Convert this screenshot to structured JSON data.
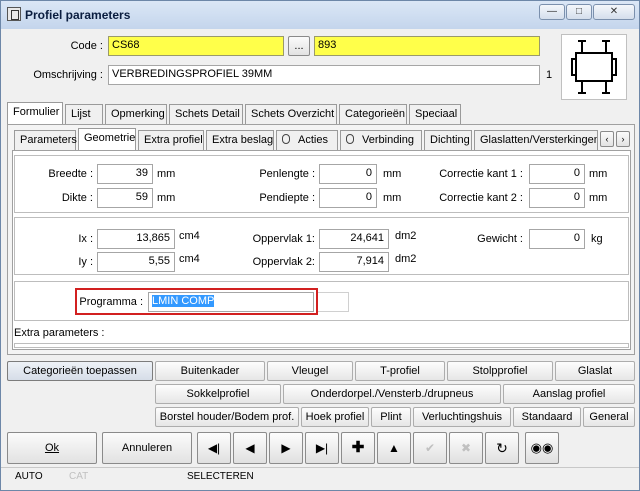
{
  "window": {
    "title": "Profiel parameters",
    "min_icon": "minimize-icon",
    "max_icon": "maximize-icon",
    "close_icon": "close-icon"
  },
  "header": {
    "code_label": "Code :",
    "code_value": "CS68",
    "browse_label": "...",
    "code_number": "893",
    "omschrijving_label": "Omschrijving :",
    "omschrijving_value": "VERBREDINGSPROFIEL 39MM",
    "counter": "1"
  },
  "main_tabs": [
    "Formulier",
    "Lijst",
    "Opmerking",
    "Schets Detail",
    "Schets Overzicht",
    "Categorieën",
    "Speciaal"
  ],
  "sub_tabs": [
    "Parameters",
    "Geometrie",
    "Extra profiel",
    "Extra beslag",
    "Acties",
    "Verbinding",
    "Dichting",
    "Glaslatten/Versterkingen"
  ],
  "geometry": {
    "breedte_label": "Breedte :",
    "breedte_value": "39",
    "breedte_unit": "mm",
    "dikte_label": "Dikte :",
    "dikte_value": "59",
    "dikte_unit": "mm",
    "penlengte_label": "Penlengte :",
    "penlengte_value": "0",
    "penlengte_unit": "mm",
    "pendiepte_label": "Pendiepte :",
    "pendiepte_value": "0",
    "pendiepte_unit": "mm",
    "correctie1_label": "Correctie kant 1 :",
    "correctie1_value": "0",
    "correctie1_unit": "mm",
    "correctie2_label": "Correctie kant 2 :",
    "correctie2_value": "0",
    "correctie2_unit": "mm",
    "ix_label": "Ix :",
    "ix_value": "13,865",
    "ix_unit": "cm4",
    "iy_label": "Iy :",
    "iy_value": "5,55",
    "iy_unit": "cm4",
    "oppervlak1_label": "Oppervlak 1:",
    "oppervlak1_value": "24,641",
    "oppervlak1_unit": "dm2",
    "oppervlak2_label": "Oppervlak 2:",
    "oppervlak2_value": "7,914",
    "oppervlak2_unit": "dm2",
    "gewicht_label": "Gewicht :",
    "gewicht_value": "0",
    "gewicht_unit": "kg",
    "programma_label": "Programma :",
    "programma_value": "LMIN COMP",
    "extra_parameters_label": "Extra parameters :"
  },
  "categories": {
    "apply_label": "Categorieën toepassen",
    "row1": [
      "Buitenkader",
      "Vleugel",
      "T-profiel",
      "Stolpprofiel",
      "Glaslat"
    ],
    "row2": [
      "Sokkelprofiel",
      "Onderdorpel./Vensterb./drupneus",
      "Aanslag profiel"
    ],
    "row3": [
      "Borstel houder/Bodem prof.",
      "Hoek profiel",
      "Plint",
      "Verluchtingshuis",
      "Standaard",
      "General"
    ]
  },
  "actions": {
    "ok_label": "Ok",
    "cancel_label": "Annuleren"
  },
  "nav_icons": [
    "first-record-icon",
    "previous-record-icon",
    "next-record-icon",
    "last-record-icon",
    "add-icon",
    "up-icon",
    "confirm-icon",
    "cancel-edit-icon",
    "refresh-icon",
    "binoculars-icon"
  ],
  "status": {
    "mode": "AUTO",
    "cat": "CAT",
    "state": "SELECTEREN"
  }
}
